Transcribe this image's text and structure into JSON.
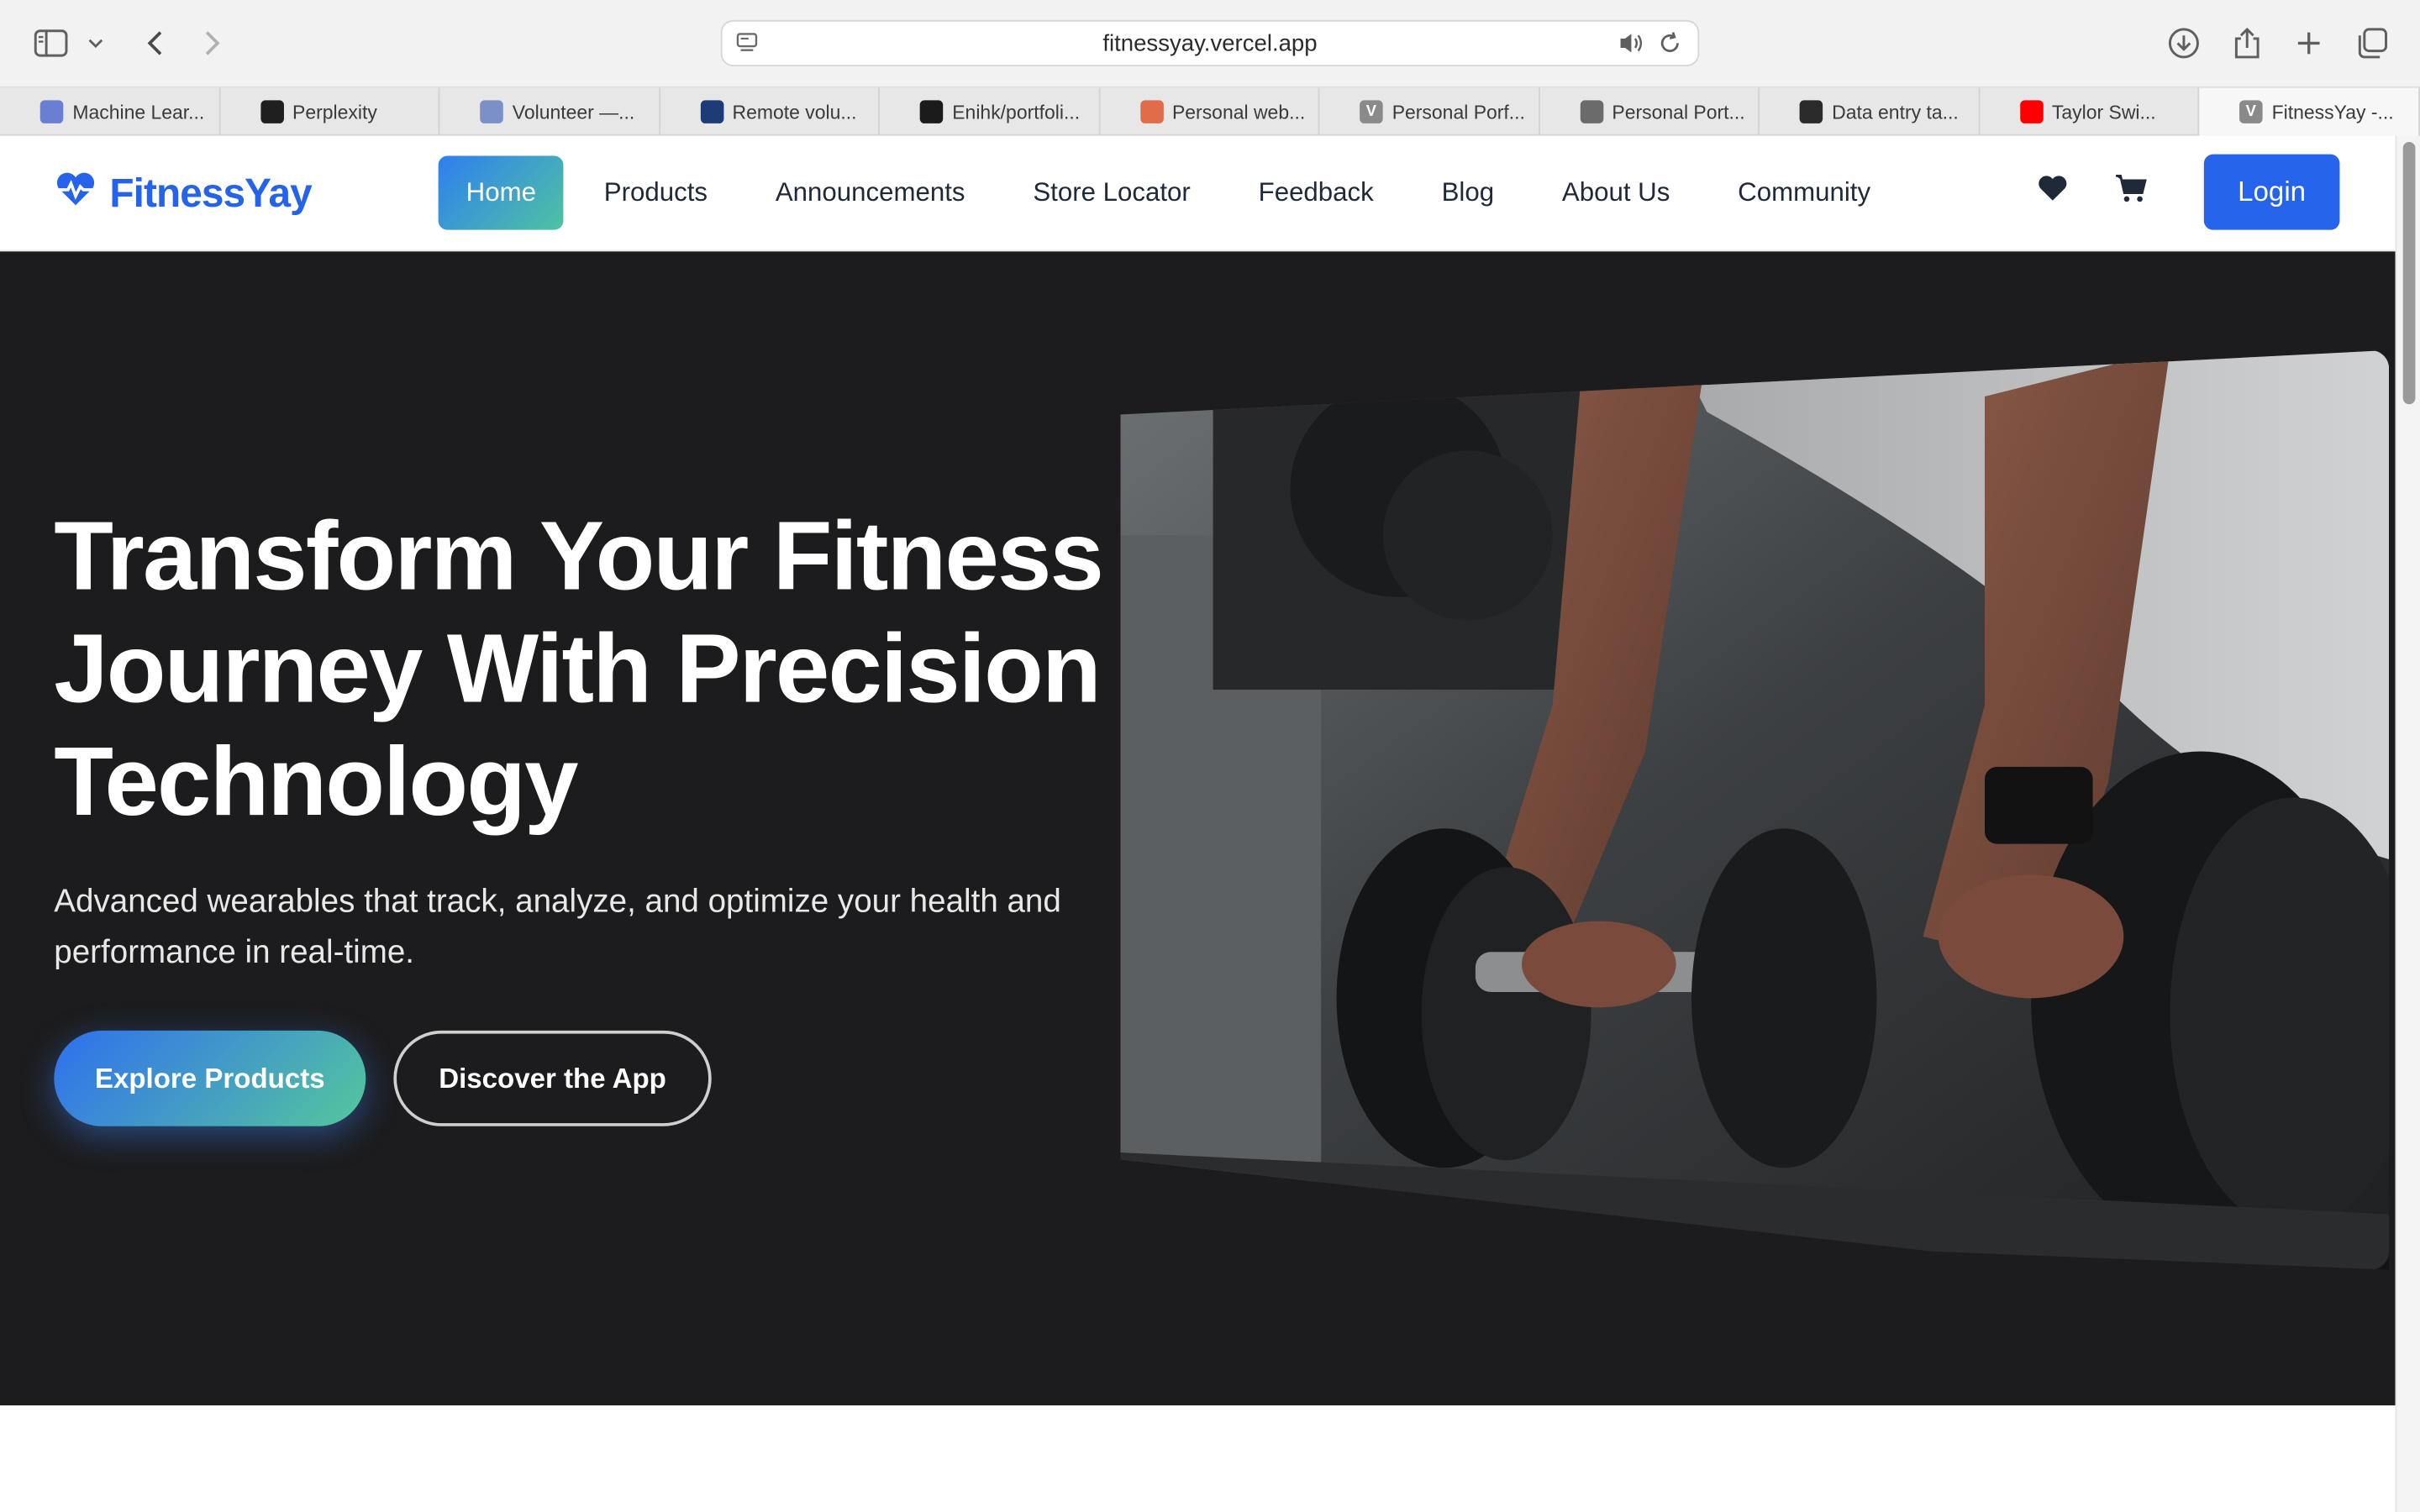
{
  "browser": {
    "url": "fitnessyay.vercel.app",
    "tabs": [
      {
        "label": "Machine Lear...",
        "icon": "graduation-cap-icon",
        "color": "#6a7fd1"
      },
      {
        "label": "Perplexity",
        "icon": "perplexity-icon",
        "color": "#1f1f1f"
      },
      {
        "label": "Volunteer —...",
        "icon": "mountain-icon",
        "color": "#7b8fc9"
      },
      {
        "label": "Remote volu...",
        "icon": "at-icon",
        "color": "#1c3c78"
      },
      {
        "label": "Enihk/portfoli...",
        "icon": "github-icon",
        "color": "#1b1b1b"
      },
      {
        "label": "Personal web...",
        "icon": "sparkle-icon",
        "color": "#e06c4a"
      },
      {
        "label": "Personal Porf...",
        "icon": "v-icon",
        "color": "#8a8a8a"
      },
      {
        "label": "Personal Port...",
        "icon": "compass-icon",
        "color": "#6b6b6b"
      },
      {
        "label": "Data entry ta...",
        "icon": "openai-icon",
        "color": "#2a2a2a"
      },
      {
        "label": "Taylor Swi...",
        "icon": "youtube-icon",
        "color": "#ff0000"
      },
      {
        "label": "FitnessYay -...",
        "icon": "v-icon",
        "color": "#8a8a8a"
      }
    ]
  },
  "site": {
    "logo_text": "FitnessYay",
    "brand_color": "#2563eb",
    "nav": [
      {
        "label": "Home",
        "active": true
      },
      {
        "label": "Products"
      },
      {
        "label": "Announcements"
      },
      {
        "label": "Store Locator"
      },
      {
        "label": "Feedback"
      },
      {
        "label": "Blog"
      },
      {
        "label": "About Us"
      },
      {
        "label": "Community"
      }
    ],
    "login_label": "Login"
  },
  "hero": {
    "title": "Transform Your Fitness Journey With Precision Technology",
    "subtitle": "Advanced wearables that track, analyze, and optimize your health and performance in real-time.",
    "primary_cta": "Explore Products",
    "secondary_cta": "Discover the App",
    "background": "#1c1c1e"
  }
}
